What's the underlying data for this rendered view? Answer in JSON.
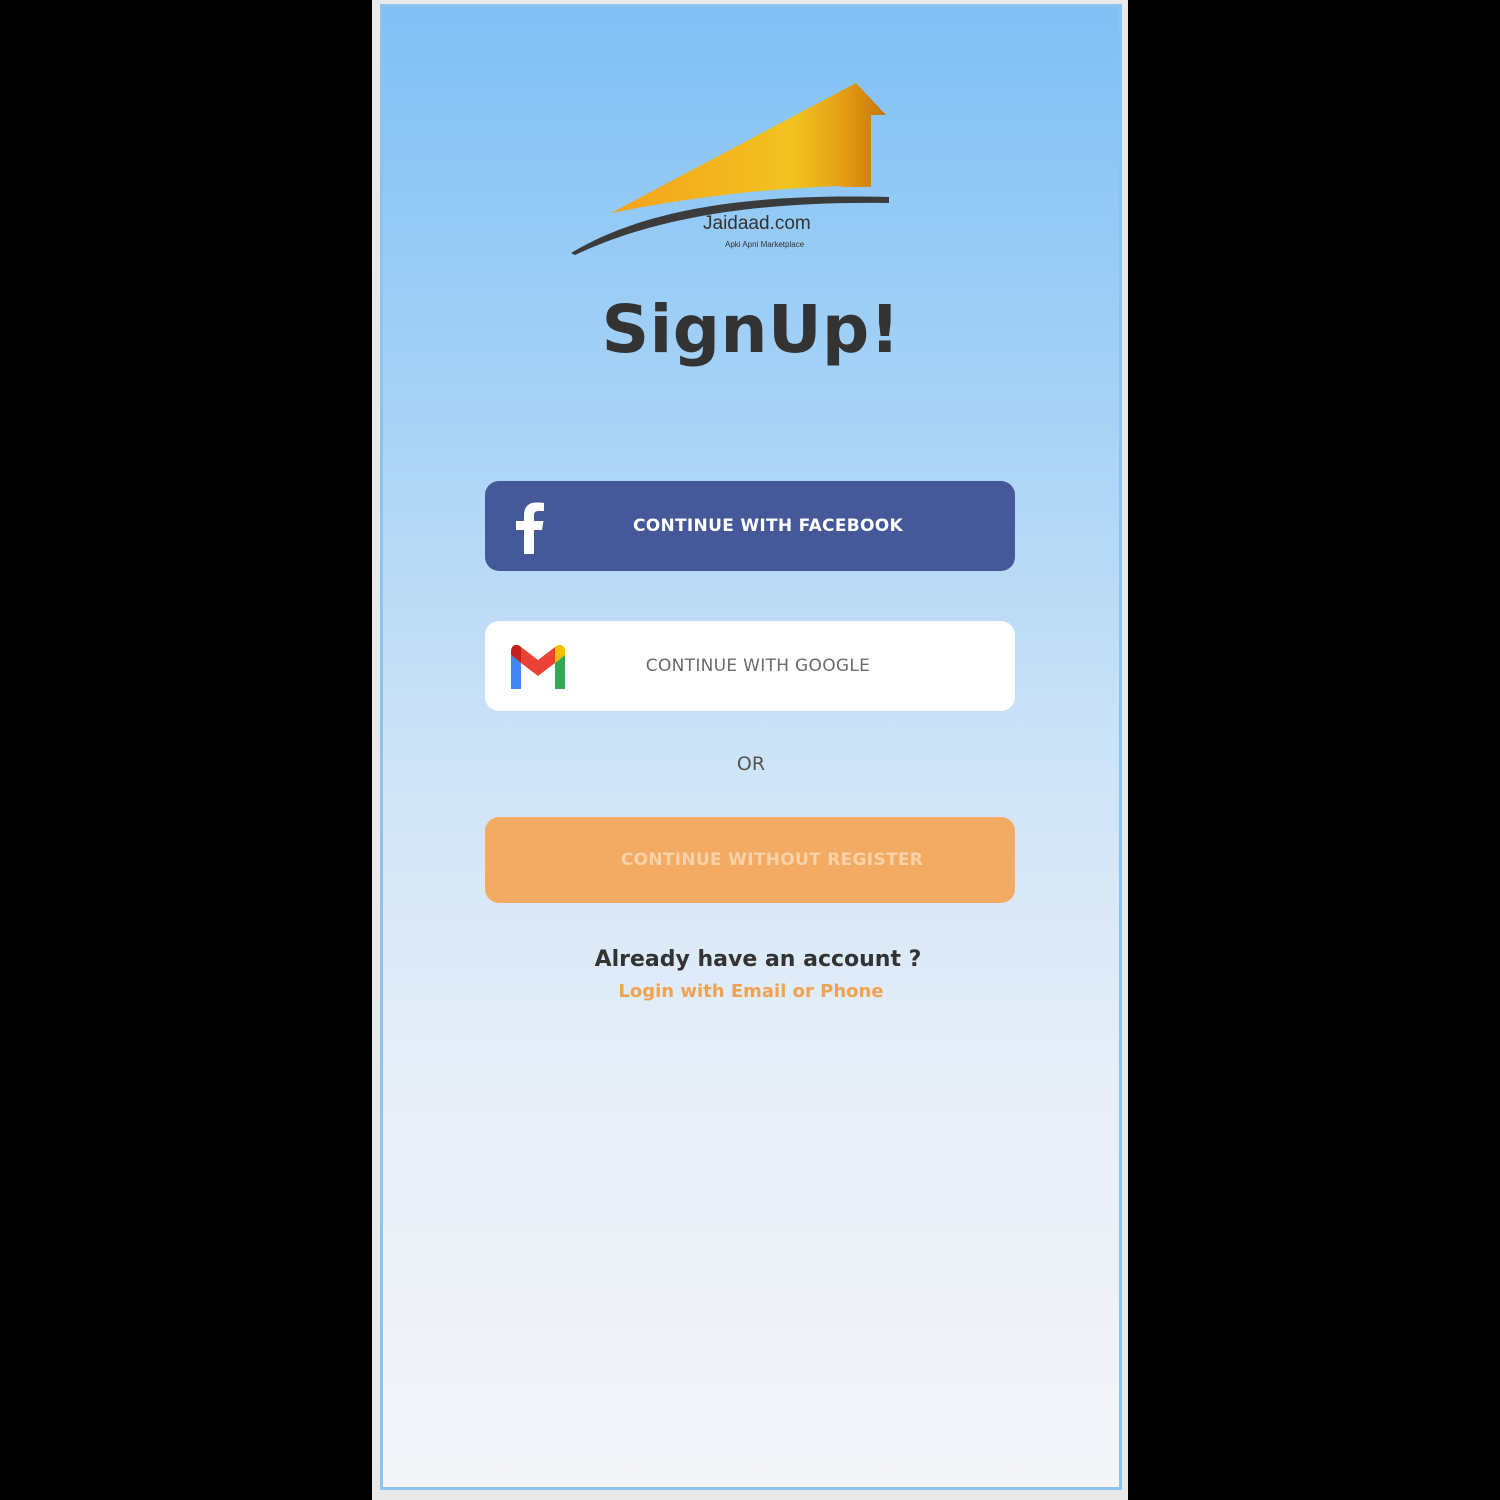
{
  "logo": {
    "brand": "Jaidaad.com",
    "tagline": "Apki Apni Marketplace"
  },
  "title": "SignUp!",
  "buttons": {
    "facebook_label": "CONTINUE WITH FACEBOOK",
    "google_label": "CONTINUE WITH GOOGLE",
    "guest_label": "CONTINUE WITHOUT REGISTER"
  },
  "divider_text": "OR",
  "account_prompt": "Already have an account ?",
  "login_link": "Login with Email or Phone",
  "colors": {
    "facebook": "#44589a",
    "guest": "#f3aa63",
    "link": "#f0a34f",
    "title": "#333333"
  },
  "icons": {
    "facebook": "facebook-icon",
    "google": "gmail-icon"
  }
}
